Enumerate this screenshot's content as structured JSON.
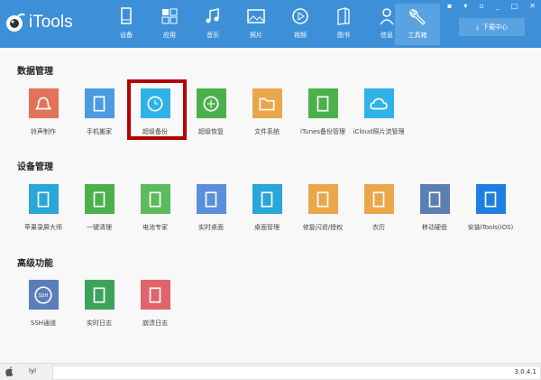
{
  "app": {
    "title": "iTools",
    "version": "3.0.4.1",
    "user": "lyl"
  },
  "nav": [
    {
      "label": "设备",
      "icon": "phone-icon"
    },
    {
      "label": "应用",
      "icon": "apps-icon"
    },
    {
      "label": "音乐",
      "icon": "music-icon"
    },
    {
      "label": "照片",
      "icon": "photo-icon"
    },
    {
      "label": "视频",
      "icon": "video-icon"
    },
    {
      "label": "图书",
      "icon": "book-icon"
    },
    {
      "label": "信息",
      "icon": "user-icon"
    },
    {
      "label": "工具箱",
      "icon": "wrench-icon",
      "active": true
    }
  ],
  "download_center": "下载中心",
  "sections": [
    {
      "title": "数据管理",
      "items": [
        {
          "label": "铃声制作",
          "color": "#e2735a"
        },
        {
          "label": "手机搬家",
          "color": "#4a9be0"
        },
        {
          "label": "超级备份",
          "color": "#2fb2e6",
          "highlighted": true
        },
        {
          "label": "超级恢复",
          "color": "#4cb04c"
        },
        {
          "label": "文件系统",
          "color": "#eaa74a"
        },
        {
          "label": "iTunes备份管理",
          "color": "#4cb04c"
        },
        {
          "label": "iCloud照片流管理",
          "color": "#2fb2e6"
        }
      ]
    },
    {
      "title": "设备管理",
      "items": [
        {
          "label": "苹果录屏大师",
          "color": "#2aa6d8"
        },
        {
          "label": "一键清理",
          "color": "#4cb04c"
        },
        {
          "label": "电池专家",
          "color": "#5cbb5c"
        },
        {
          "label": "实时桌面",
          "color": "#5b8fdc"
        },
        {
          "label": "桌面管理",
          "color": "#2aa6d8"
        },
        {
          "label": "修复闪退/授权",
          "color": "#eaa74a"
        },
        {
          "label": "农历",
          "color": "#eaa74a"
        },
        {
          "label": "移动硬盘",
          "color": "#5a7fb0"
        },
        {
          "label": "安装iTools(iOS)",
          "color": "#1f7fe0"
        }
      ]
    },
    {
      "title": "高级功能",
      "items": [
        {
          "label": "SSH通道",
          "color": "#5a7fb8"
        },
        {
          "label": "实时日志",
          "color": "#3ea35a"
        },
        {
          "label": "崩溃日志",
          "color": "#e0646a"
        }
      ]
    }
  ]
}
